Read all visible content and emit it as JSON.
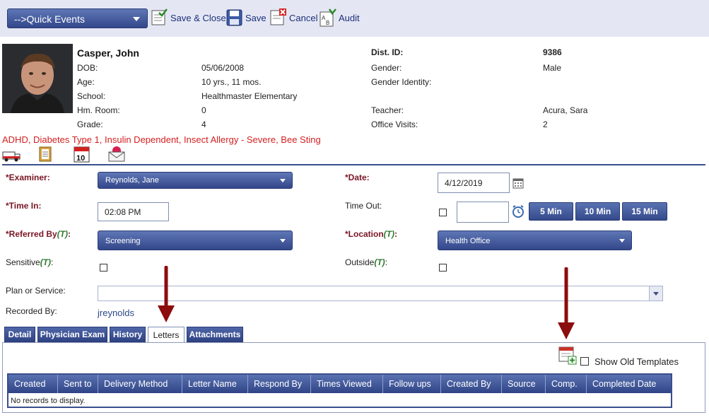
{
  "toolbar": {
    "quick_events": "-->Quick Events",
    "save_close": "Save & Close",
    "save": "Save",
    "cancel": "Cancel",
    "audit": "Audit"
  },
  "student": {
    "name": "Casper, John",
    "dob_label": "DOB:",
    "dob": "05/06/2008",
    "age_label": "Age:",
    "age": "10 yrs., 11 mos.",
    "school_label": "School:",
    "school": "Healthmaster Elementary",
    "hmroom_label": "Hm. Room:",
    "hmroom": "0",
    "grade_label": "Grade:",
    "grade": "4",
    "distid_label": "Dist. ID:",
    "distid": "9386",
    "gender_label": "Gender:",
    "gender": "Male",
    "gender_identity_label": "Gender Identity:",
    "teacher_label": "Teacher:",
    "teacher": "Acura, Sara",
    "visits_label": "Office Visits:",
    "visits": "2",
    "alerts": "ADHD, Diabetes Type 1, Insulin Dependent, Insect Allergy - Severe, Bee Sting",
    "calendar_day": "10"
  },
  "form": {
    "examiner_label": "*Examiner:",
    "examiner": "Reynolds, Jane",
    "date_label": "*Date:",
    "date": "4/12/2019",
    "timein_label": "*Time In:",
    "timein": "02:08 PM",
    "timeout_label": "Time Out:",
    "timeout": "",
    "min5": "5 Min",
    "min10": "10 Min",
    "min15": "15 Min",
    "referred_label": "*Referred By",
    "t": "(T)",
    "colon": ":",
    "referred": "Screening",
    "location_label": "*Location",
    "location": "Health Office",
    "sensitive_label": "Sensitive",
    "outside_label": "Outside",
    "plan_label": "Plan or Service:",
    "plan": "",
    "recorded_label": "Recorded By:",
    "recorded": "jreynolds"
  },
  "tabs": [
    "Detail",
    "Physician Exam",
    "History",
    "Letters",
    "Attachments"
  ],
  "active_tab": "Letters",
  "letters": {
    "show_old": "Show Old Templates",
    "columns": [
      "Created",
      "Sent to",
      "Delivery Method",
      "Letter Name",
      "Respond By",
      "Times Viewed",
      "Follow ups",
      "Created By",
      "Source",
      "Comp.",
      "Completed Date"
    ],
    "empty": "No records to display."
  },
  "colors": {
    "accent": "#3a4e8c",
    "alert": "#d42020",
    "required": "#7a1524",
    "arrow": "#8b0d0d"
  }
}
